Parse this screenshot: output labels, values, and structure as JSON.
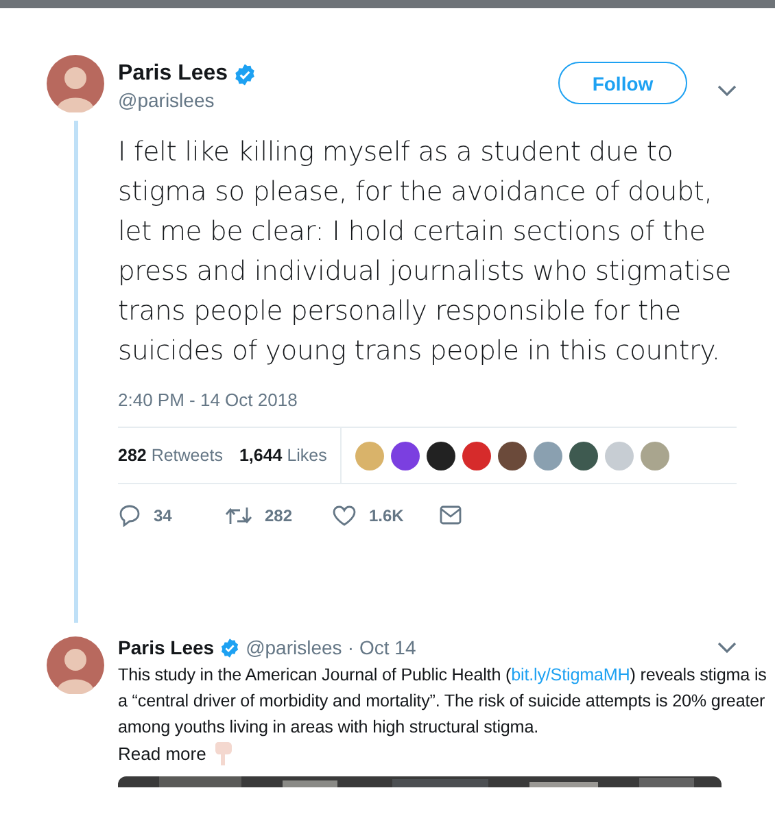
{
  "main_tweet": {
    "author": {
      "name": "Paris Lees",
      "handle": "@parislees",
      "verified": true
    },
    "follow_button": "Follow",
    "text": "I felt like killing myself as a student due to stigma so please, for the avoidance of doubt, let me be clear: I hold certain sections of the press and individual journalists who stigmatise trans people personally responsible for the suicides of young trans people in this country.",
    "timestamp": "2:40 PM - 14 Oct 2018",
    "stats": [
      {
        "count": "282",
        "label": "Retweets"
      },
      {
        "count": "1,644",
        "label": "Likes"
      }
    ],
    "actions": [
      {
        "kind": "reply",
        "count": "34"
      },
      {
        "kind": "retweet",
        "count": "282"
      },
      {
        "kind": "like",
        "count": "1.6K"
      },
      {
        "kind": "message"
      }
    ]
  },
  "reply_tweet": {
    "author": {
      "name": "Paris Lees",
      "handle": "@parislees",
      "verified": true
    },
    "separator": "·",
    "date": "Oct 14",
    "text_before": "This study in the American Journal of Public Health (",
    "link": "bit.ly/StigmaMH",
    "text_after": ") reveals stigma is a “central driver of morbidity and mortality”. The risk of suicide attempts is 20% greater among youths living in areas with high structural stigma.",
    "read_more": "Read more"
  }
}
